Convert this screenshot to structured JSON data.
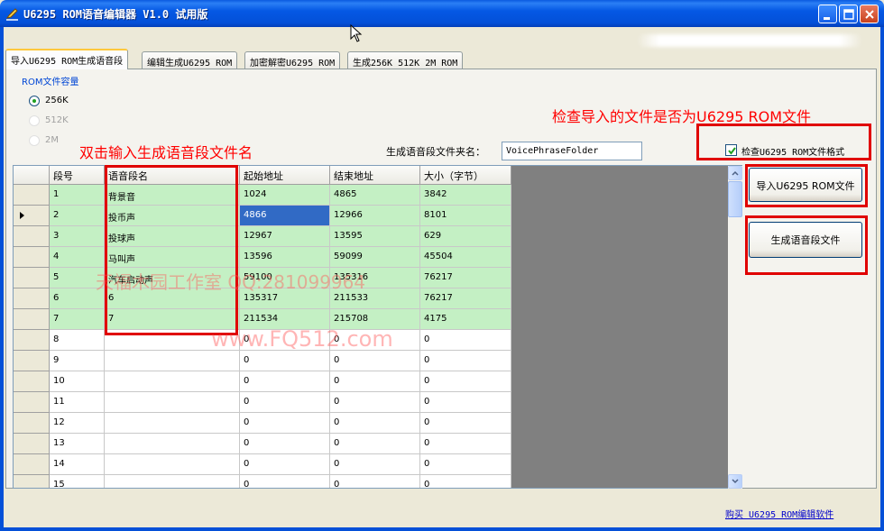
{
  "window": {
    "title": "U6295 ROM语音编辑器 V1.0 试用版"
  },
  "tabs": [
    {
      "label": "导入U6295 ROM生成语音段",
      "active": true
    },
    {
      "label": "编辑生成U6295 ROM",
      "active": false
    },
    {
      "label": "加密解密U6295 ROM",
      "active": false
    },
    {
      "label": "生成256K 512K 2M ROM",
      "active": false
    }
  ],
  "rom_capacity": {
    "label": "ROM文件容量",
    "options": [
      {
        "label": "256K",
        "selected": true,
        "enabled": true
      },
      {
        "label": "512K",
        "selected": false,
        "enabled": false
      },
      {
        "label": "2M",
        "selected": false,
        "enabled": false
      }
    ]
  },
  "folder": {
    "label": "生成语音段文件夹名：",
    "value": "VoicePhraseFolder"
  },
  "check_format": {
    "label": "检查U6295 ROM文件格式",
    "checked": true
  },
  "annotations": {
    "check_note": "检查导入的文件是否为U6295 ROM文件",
    "name_note": "双击输入生成语音段文件名"
  },
  "grid": {
    "headers": [
      "段号",
      "语音段名",
      "起始地址",
      "结束地址",
      "大小（字节）"
    ],
    "rows": [
      [
        "1",
        "背景音",
        "1024",
        "4865",
        "3842"
      ],
      [
        "2",
        "投币声",
        "4866",
        "12966",
        "8101"
      ],
      [
        "3",
        "投球声",
        "12967",
        "13595",
        "629"
      ],
      [
        "4",
        "马叫声",
        "13596",
        "59099",
        "45504"
      ],
      [
        "5",
        "汽车启动声",
        "59100",
        "135316",
        "76217"
      ],
      [
        "6",
        "6",
        "135317",
        "211533",
        "76217"
      ],
      [
        "7",
        "7",
        "211534",
        "215708",
        "4175"
      ],
      [
        "8",
        "",
        "0",
        "0",
        "0"
      ],
      [
        "9",
        "",
        "0",
        "0",
        "0"
      ],
      [
        "10",
        "",
        "0",
        "0",
        "0"
      ],
      [
        "11",
        "",
        "0",
        "0",
        "0"
      ],
      [
        "12",
        "",
        "0",
        "0",
        "0"
      ],
      [
        "13",
        "",
        "0",
        "0",
        "0"
      ],
      [
        "14",
        "",
        "0",
        "0",
        "0"
      ],
      [
        "15",
        "",
        "0",
        "0",
        "0"
      ]
    ],
    "filled_rows": 7,
    "selected_row": 2,
    "selected_col": 3
  },
  "buttons": {
    "import": "导入U6295 ROM文件",
    "generate": "生成语音段文件"
  },
  "watermark": {
    "line1": "天福木园工作室 QQ:281099964",
    "line2": "www.FQ512.com"
  },
  "footer": {
    "buy_link": "购买 U6295 ROM编辑软件"
  },
  "colors": {
    "filled_row": "#c4f0c4",
    "annotation": "#ff0000",
    "titlebar": "#0558e4"
  }
}
